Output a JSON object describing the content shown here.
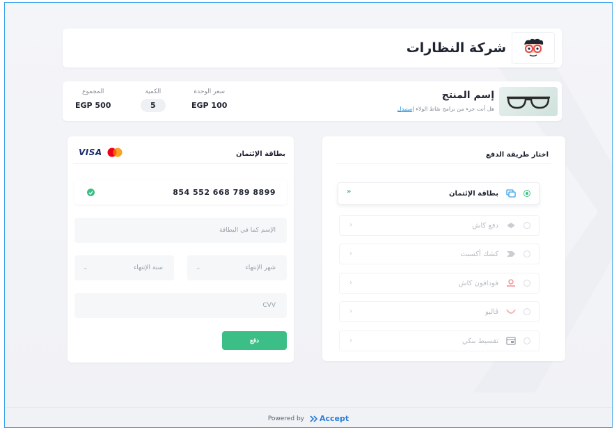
{
  "company": {
    "name": "شركة النظارات",
    "logo_icon": "glasses-mascot-icon"
  },
  "product": {
    "name": "إسم المنتج",
    "loyalty_text": "هل أنت جزء من برامج  نقاط الولاء",
    "loyalty_link": "إستبدل",
    "unit_price_label": "سعر الوحدة",
    "unit_price": "EGP 100",
    "quantity_label": "الكمية",
    "quantity": "5",
    "total_label": "المجموع",
    "total": "EGP 500"
  },
  "card_form": {
    "title": "بطاقة الإئتمان",
    "brand_visa": "VISA",
    "card_number": "854 552 668 789 8899",
    "name_placeholder": "الإسم كما في البطاقة",
    "expiry_month_placeholder": "شهر الإنتهاء",
    "expiry_year_placeholder": "سنة الإنتهاء",
    "cvv_placeholder": "CVV",
    "pay_label": "دفع"
  },
  "payment_methods": {
    "title": "اختار طريقة الدفع",
    "items": [
      {
        "label": "بطاقة الإئتمان",
        "icon": "credit-card-icon",
        "selected": true
      },
      {
        "label": "دفع كاش",
        "icon": "cash-icon",
        "selected": false
      },
      {
        "label": "كشك أكسبت",
        "icon": "kiosk-icon",
        "selected": false
      },
      {
        "label": "فودافون كاش",
        "icon": "vodafone-icon",
        "selected": false
      },
      {
        "label": "ڤاليو",
        "icon": "valu-icon",
        "selected": false
      },
      {
        "label": "تقسيط بنكي",
        "icon": "bank-installment-icon",
        "selected": false
      }
    ]
  },
  "footer": {
    "powered_by": "Powered by",
    "brand": "Accept"
  },
  "colors": {
    "accent": "#3bbf86",
    "link": "#2b8fd6",
    "brand_blue": "#2b7fd6"
  }
}
